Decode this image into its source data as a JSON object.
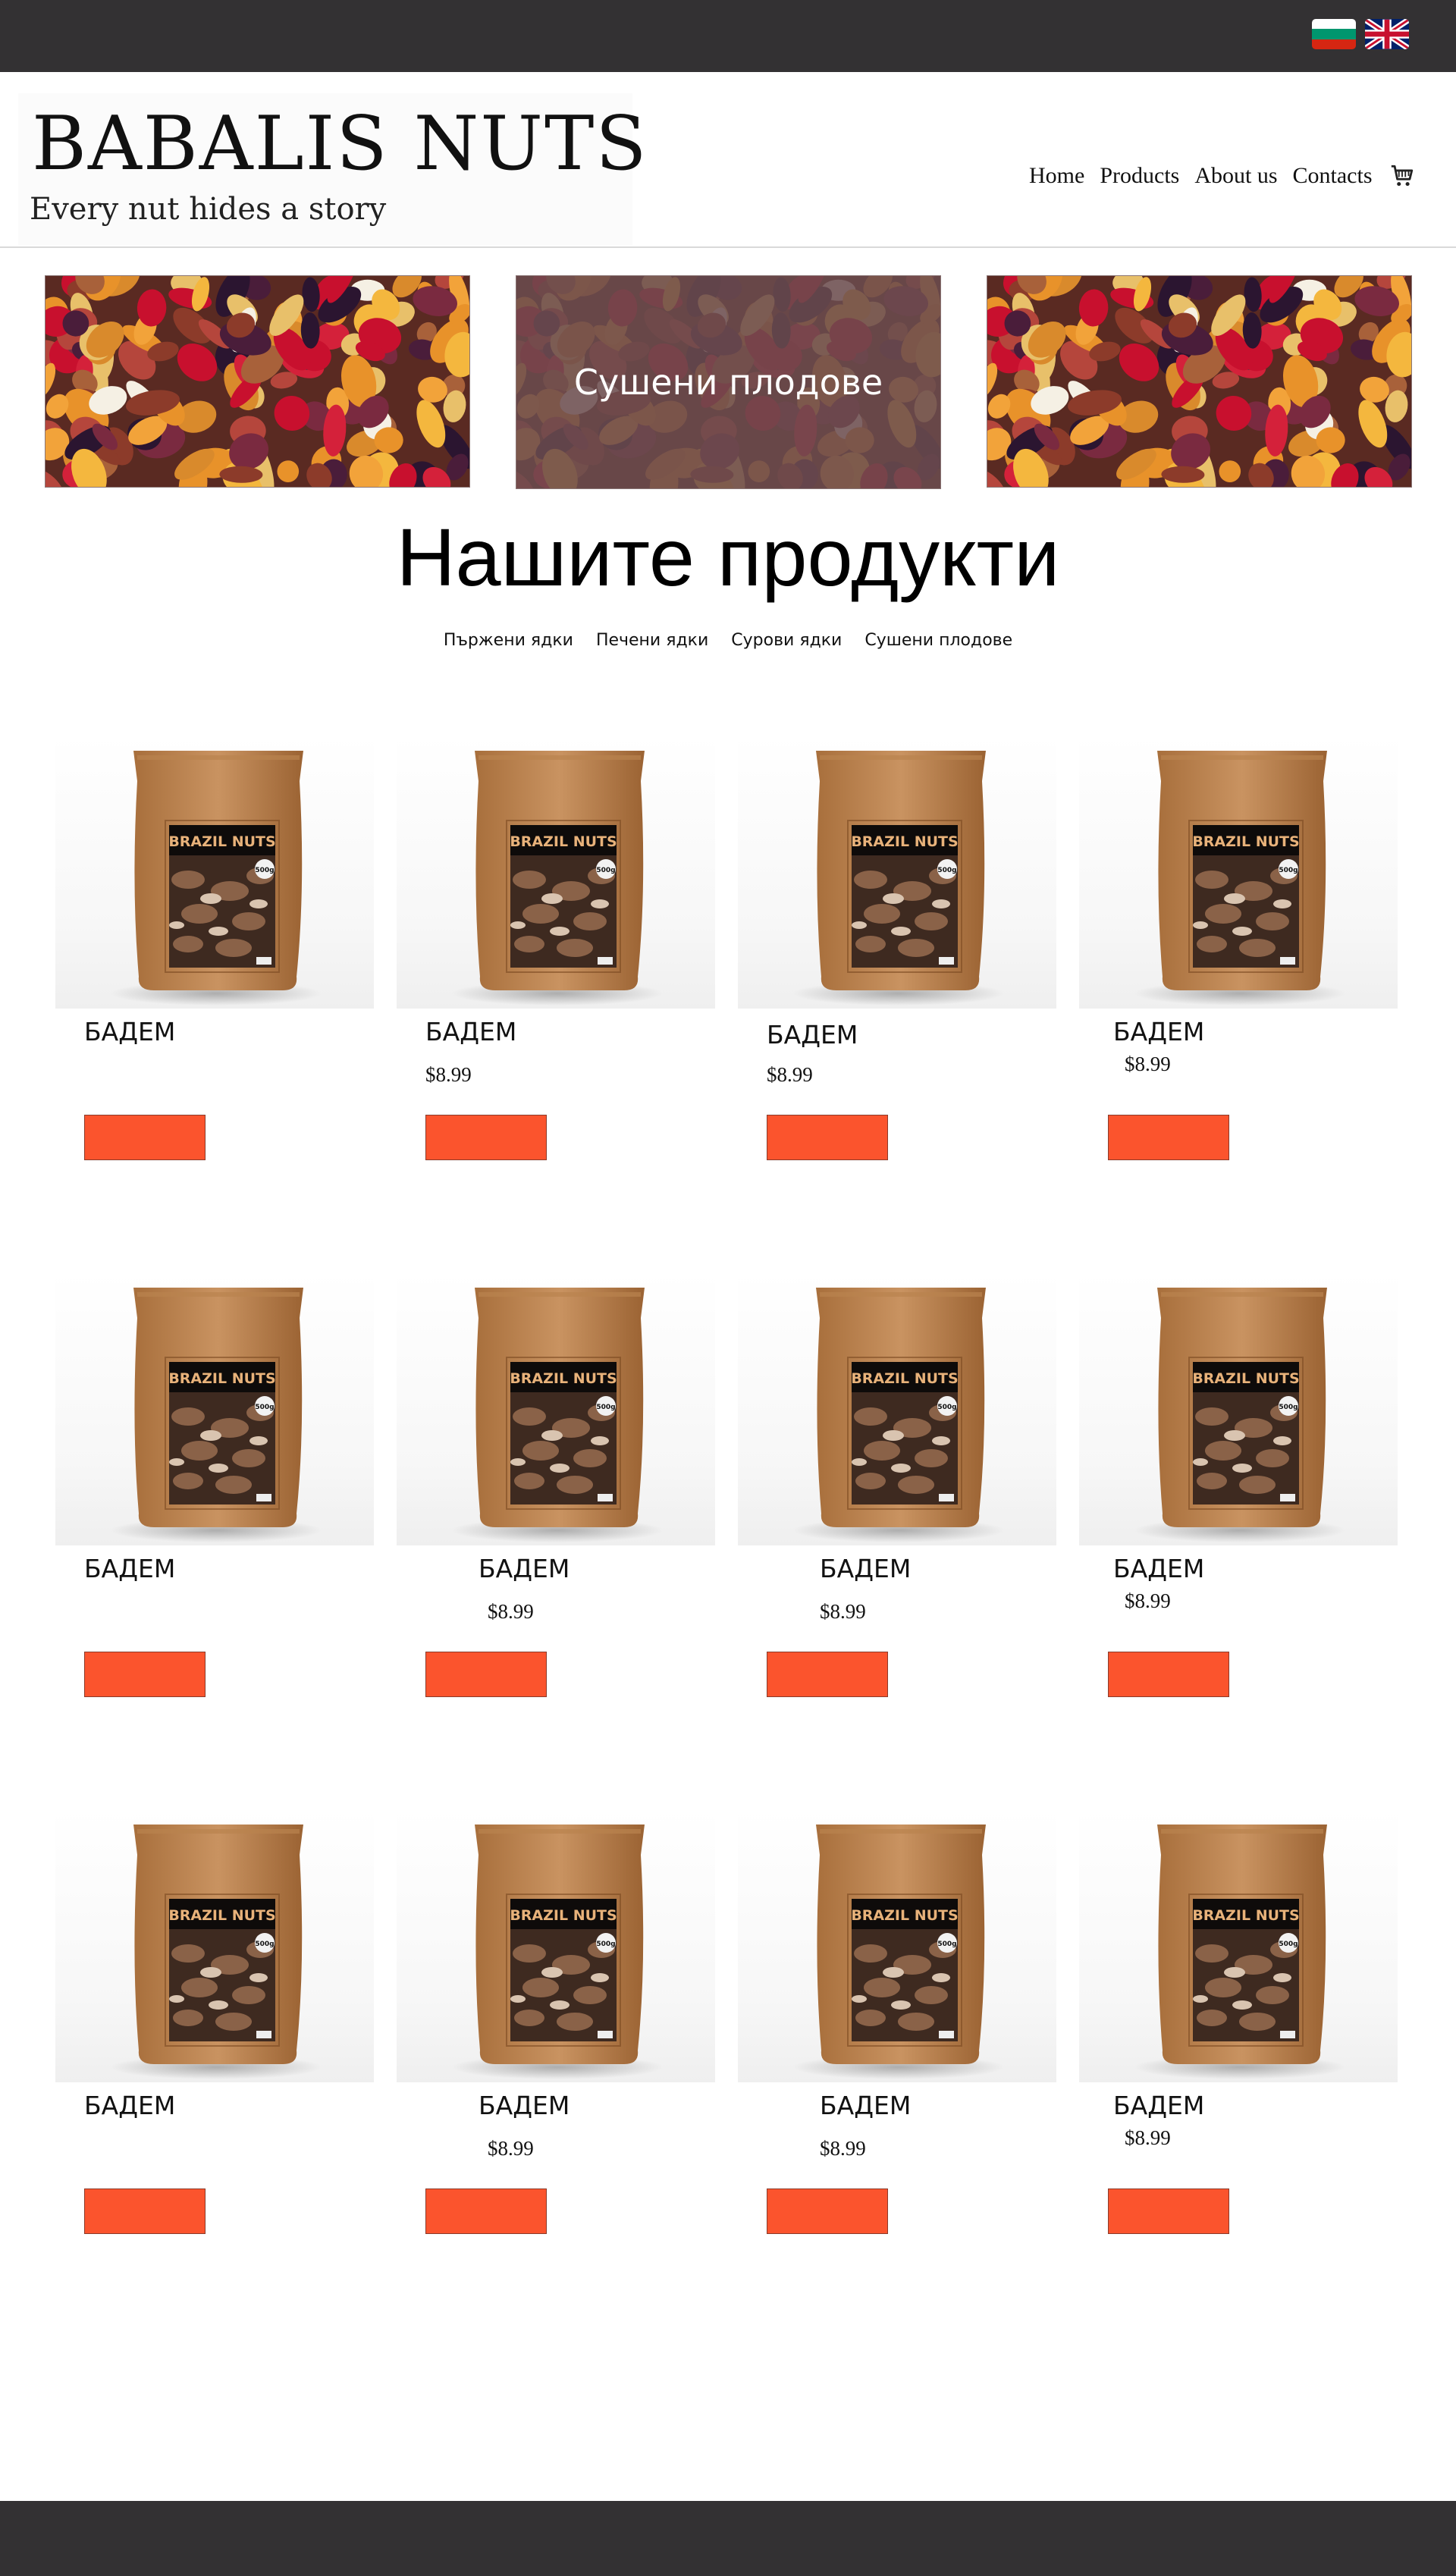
{
  "languages": [
    {
      "code": "bg",
      "icon": "bulgarian-flag-icon"
    },
    {
      "code": "en",
      "icon": "uk-flag-icon"
    }
  ],
  "header": {
    "brand": "BABALIS NUTS",
    "tagline": "Every nut hides a story",
    "nav": [
      "Home",
      "Products",
      "About us",
      "Contacts"
    ],
    "cart_icon": "shopping-cart-icon"
  },
  "banners": [
    {
      "title": ""
    },
    {
      "title": "Сушени плодове"
    },
    {
      "title": ""
    }
  ],
  "products_section": {
    "title": "Нашите продукти",
    "filters": [
      "Пържени ядки",
      "Печени ядки",
      "Сурови ядки",
      "Сушени плодове"
    ]
  },
  "products": [
    {
      "name": "БАДЕМ",
      "price": ""
    },
    {
      "name": "БАДЕМ",
      "price": "$8.99"
    },
    {
      "name": "БАДЕМ",
      "price": "$8.99"
    },
    {
      "name": "БАДЕМ",
      "price": "$8.99"
    },
    {
      "name": "БАДЕМ",
      "price": ""
    },
    {
      "name": "БАДЕМ",
      "price": "$8.99"
    },
    {
      "name": "БАДЕМ",
      "price": "$8.99"
    },
    {
      "name": "БАДЕМ",
      "price": "$8.99"
    },
    {
      "name": "БАДЕМ",
      "price": ""
    },
    {
      "name": "БАДЕМ",
      "price": "$8.99"
    },
    {
      "name": "БАДЕМ",
      "price": "$8.99"
    },
    {
      "name": "БАДЕМ",
      "price": "$8.99"
    }
  ],
  "product_image": {
    "label": "BRAZIL NUTS",
    "weight": "500g"
  },
  "colors": {
    "topbar": "#333133",
    "button": "#fb542d",
    "banner_overlay": "#6a4c4f"
  }
}
